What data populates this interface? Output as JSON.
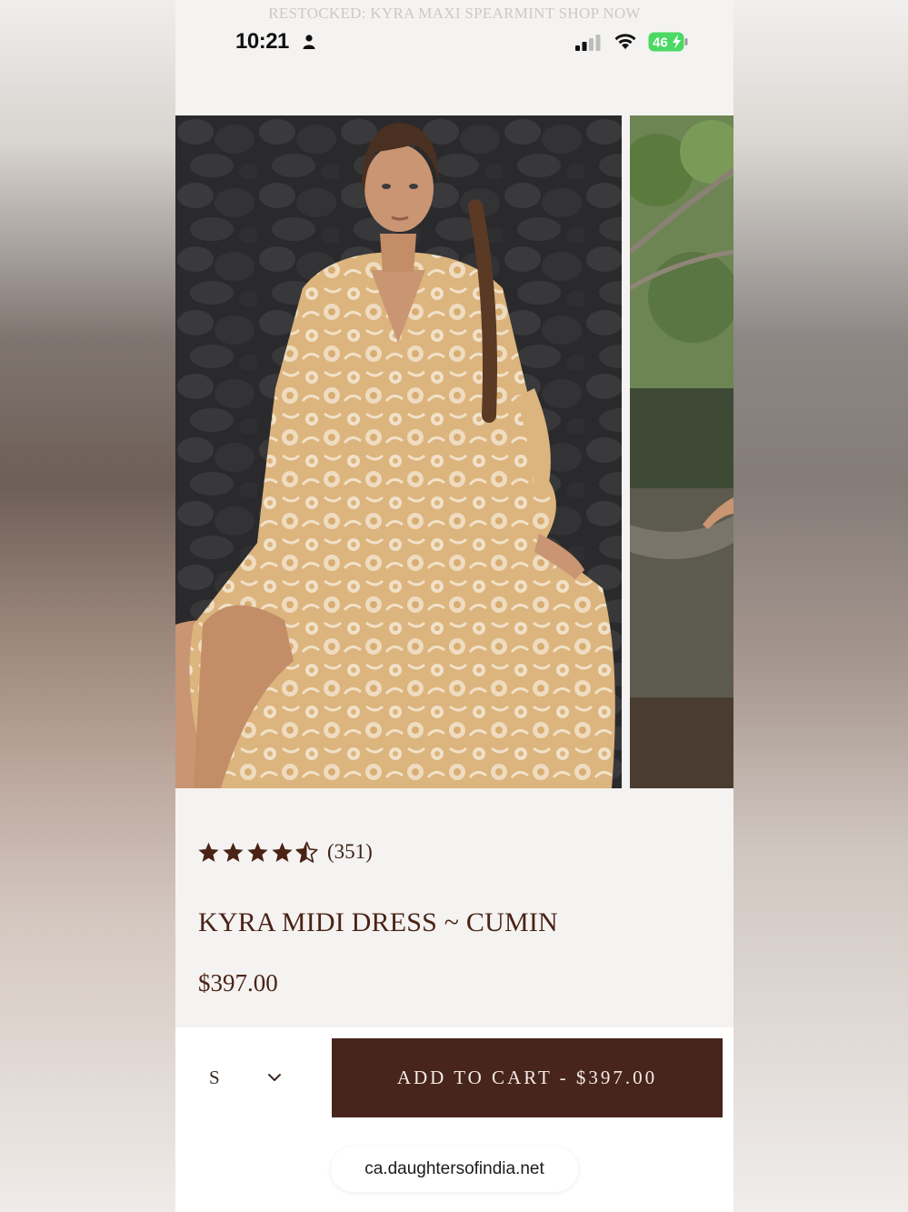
{
  "announcement": {
    "text": "RESTOCKED: KYRA MAXI SPEARMINT  SHOP NOW"
  },
  "status_bar": {
    "time": "10:21",
    "battery": "46"
  },
  "gallery": {
    "images": [
      "model-in-floral-dress",
      "model-by-river"
    ]
  },
  "product": {
    "rating": 4.5,
    "review_count": "(351)",
    "title": "KYRA MIDI DRESS ~ CUMIN",
    "price": "$397.00"
  },
  "purchase": {
    "size_selected": "S",
    "add_to_cart_label": "ADD TO CART - $397.00"
  },
  "browser": {
    "url": "ca.daughtersofindia.net"
  },
  "colors": {
    "brand_dark": "#47251c",
    "star": "#4a2316",
    "page_bg": "#f5f3f1"
  }
}
